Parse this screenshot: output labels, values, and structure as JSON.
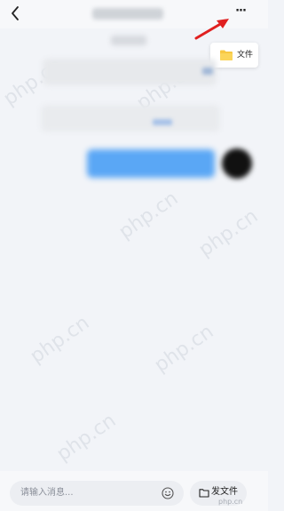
{
  "header": {
    "back_icon": "chevron-left-icon",
    "more_label": "···"
  },
  "popup_menu": {
    "items": [
      {
        "label": "文件",
        "icon": "folder-icon",
        "icon_color": "#f7c843"
      }
    ]
  },
  "annotation": {
    "arrow_color": "#e02020"
  },
  "input_bar": {
    "placeholder": "请输入消息...",
    "emoji_icon": "smiley-icon",
    "send_file_label": "发文件",
    "send_file_icon": "folder-outline-icon"
  },
  "watermarks": {
    "text": "php.cn",
    "corner_text": "php.cn"
  },
  "colors": {
    "background": "#f2f4f8",
    "outgoing_bubble": "#5aa7f5",
    "folder": "#f7c843"
  }
}
